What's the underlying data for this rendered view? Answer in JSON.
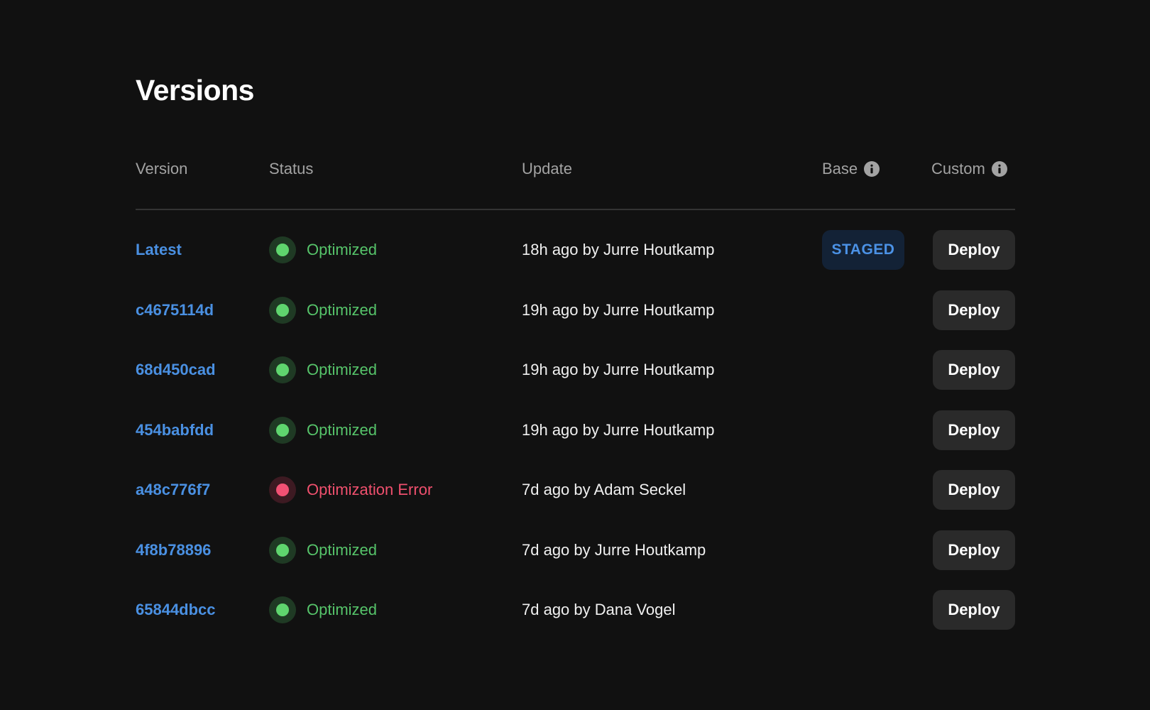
{
  "page": {
    "title": "Versions"
  },
  "table": {
    "headers": {
      "version": "Version",
      "status": "Status",
      "update": "Update",
      "base": "Base",
      "custom": "Custom"
    },
    "rows": [
      {
        "version": "Latest",
        "status": "Optimized",
        "status_kind": "success",
        "update": "18h ago by Jurre Houtkamp",
        "base_badge": "STAGED",
        "action": "Deploy"
      },
      {
        "version": "c4675114d",
        "status": "Optimized",
        "status_kind": "success",
        "update": "19h ago by Jurre Houtkamp",
        "base_badge": "",
        "action": "Deploy"
      },
      {
        "version": "68d450cad",
        "status": "Optimized",
        "status_kind": "success",
        "update": "19h ago by Jurre Houtkamp",
        "base_badge": "",
        "action": "Deploy"
      },
      {
        "version": "454babfdd",
        "status": "Optimized",
        "status_kind": "success",
        "update": "19h ago by Jurre Houtkamp",
        "base_badge": "",
        "action": "Deploy"
      },
      {
        "version": "a48c776f7",
        "status": "Optimization Error",
        "status_kind": "error",
        "update": "7d ago by Adam Seckel",
        "base_badge": "",
        "action": "Deploy"
      },
      {
        "version": "4f8b78896",
        "status": "Optimized",
        "status_kind": "success",
        "update": "7d ago by Jurre Houtkamp",
        "base_badge": "",
        "action": "Deploy"
      },
      {
        "version": "65844dbcc",
        "status": "Optimized",
        "status_kind": "success",
        "update": "7d ago by Dana Vogel",
        "base_badge": "",
        "action": "Deploy"
      }
    ]
  },
  "colors": {
    "background": "#111111",
    "link": "#4a90e2",
    "success_text": "#56c46a",
    "success_dot": "#5fd56e",
    "success_ring": "#1f3a24",
    "error_text": "#f0506e",
    "error_dot": "#f25174",
    "error_ring": "#3d1a22",
    "staged_bg": "#132236",
    "staged_text": "#4b92e6"
  },
  "icons": {
    "info": "info-icon",
    "status": "status-dot-icon"
  }
}
